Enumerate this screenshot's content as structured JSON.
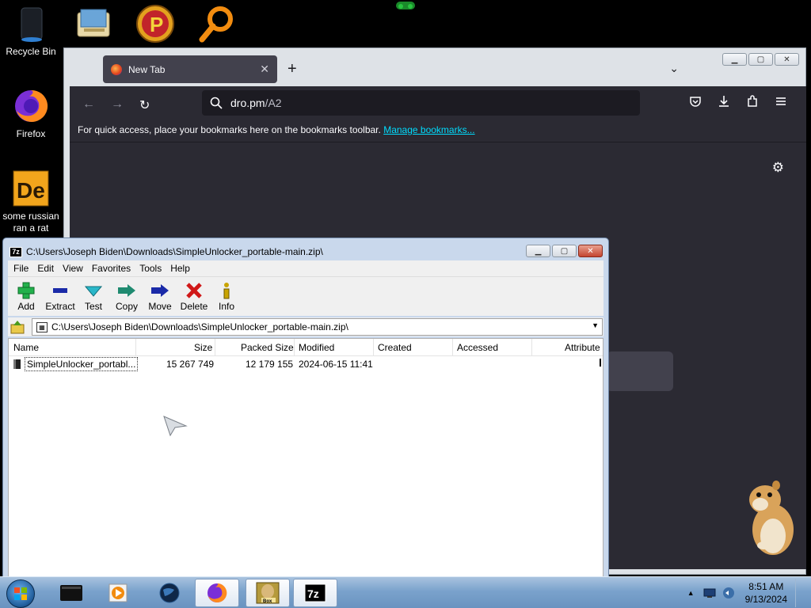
{
  "desktop": {
    "icons": [
      {
        "label": "Recycle Bin"
      },
      {
        "label": "Firefox"
      },
      {
        "label": "some russian ran a rat"
      }
    ]
  },
  "firefox": {
    "tab_title": "New Tab",
    "url_host": "dro.pm",
    "url_path": "/A2",
    "bookmarks_message": "For quick access, place your bookmarks here on the bookmarks toolbar.",
    "manage_bookmarks_link": "Manage bookmarks..."
  },
  "zip": {
    "title": "C:\\Users\\Joseph Biden\\Downloads\\SimpleUnlocker_portable-main.zip\\",
    "menu": [
      "File",
      "Edit",
      "View",
      "Favorites",
      "Tools",
      "Help"
    ],
    "toolbar": [
      {
        "label": "Add",
        "icon": "add-icon",
        "color": "#22b14c"
      },
      {
        "label": "Extract",
        "icon": "extract-icon",
        "color": "#1a2aa8"
      },
      {
        "label": "Test",
        "icon": "test-icon",
        "color": "#2ab7c9"
      },
      {
        "label": "Copy",
        "icon": "copy-icon",
        "color": "#1f8a70"
      },
      {
        "label": "Move",
        "icon": "move-icon",
        "color": "#1a2aa8"
      },
      {
        "label": "Delete",
        "icon": "delete-icon",
        "color": "#d01818"
      },
      {
        "label": "Info",
        "icon": "info-icon",
        "color": "#c9a400"
      }
    ],
    "address": "C:\\Users\\Joseph Biden\\Downloads\\SimpleUnlocker_portable-main.zip\\",
    "columns": [
      "Name",
      "Size",
      "Packed Size",
      "Modified",
      "Created",
      "Accessed",
      "Attribute"
    ],
    "rows": [
      {
        "name": "SimpleUnlocker_portabl...",
        "size": "15 267 749",
        "packed_size": "12 179 155",
        "modified": "2024-06-15 11:41",
        "created": "",
        "accessed": ""
      }
    ]
  },
  "taskbar": {
    "time": "8:51 AM",
    "date": "9/13/2024"
  }
}
